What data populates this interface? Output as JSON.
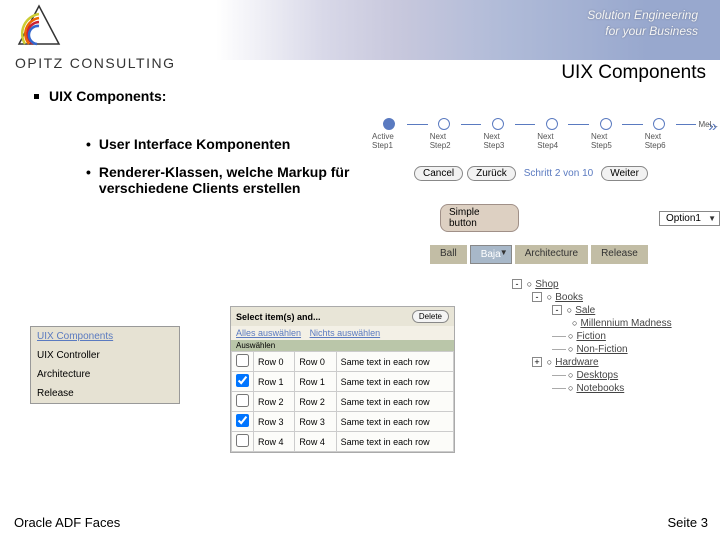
{
  "header": {
    "tagline_l1": "Solution Engineering",
    "tagline_l2": "for your Business",
    "logo_text_1": "OPITZ",
    "logo_text_2": "CONSULTING"
  },
  "page_title": "UIX Components",
  "subtitle": "UIX Components:",
  "bullets": [
    "User Interface Komponenten",
    "Renderer-Klassen, welche Markup für verschiedene Clients erstellen"
  ],
  "wizard": {
    "steps": [
      "Active Step1",
      "Next Step2",
      "Next Step3",
      "Next Step4",
      "Next Step5",
      "Next Step6",
      "Mel..."
    ]
  },
  "dlgnav": {
    "cancel": "Cancel",
    "back": "Zurück",
    "hint": "Schritt 2 von 10",
    "next": "Weiter"
  },
  "simple_button": "Simple button",
  "select_value": "Option1",
  "tabs": [
    "Ball",
    "Baja",
    "Architecture",
    "Release"
  ],
  "sidebar_list": [
    "UIX Components",
    "UIX Controller",
    "Architecture",
    "Release"
  ],
  "table": {
    "title": "Select item(s) and...",
    "delete": "Delete",
    "select_all": "Alles auswählen",
    "select_none": "Nichts auswählen",
    "auswaehlen": "Auswählen",
    "rows": [
      {
        "checked": false,
        "c1": "Row 0",
        "c2": "Row 0",
        "c3": "Same text in each row"
      },
      {
        "checked": true,
        "c1": "Row 1",
        "c2": "Row 1",
        "c3": "Same text in each row"
      },
      {
        "checked": false,
        "c1": "Row 2",
        "c2": "Row 2",
        "c3": "Same text in each row"
      },
      {
        "checked": true,
        "c1": "Row 3",
        "c2": "Row 3",
        "c3": "Same text in each row"
      },
      {
        "checked": false,
        "c1": "Row 4",
        "c2": "Row 4",
        "c3": "Same text in each row"
      }
    ]
  },
  "tree": [
    {
      "lvl": 0,
      "exp": "-",
      "label": "Shop"
    },
    {
      "lvl": 1,
      "exp": "-",
      "label": "Books"
    },
    {
      "lvl": 2,
      "exp": "-",
      "label": "Sale"
    },
    {
      "lvl": 3,
      "exp": "",
      "label": "Millennium Madness"
    },
    {
      "lvl": 2,
      "exp": "",
      "label": "Fiction",
      "branch": true
    },
    {
      "lvl": 2,
      "exp": "",
      "label": "Non-Fiction",
      "branch": true
    },
    {
      "lvl": 1,
      "exp": "+",
      "label": "Hardware"
    },
    {
      "lvl": 2,
      "exp": "",
      "label": "Desktops",
      "branch": true
    },
    {
      "lvl": 2,
      "exp": "",
      "label": "Notebooks",
      "branch": true
    }
  ],
  "footer": {
    "left": "Oracle ADF Faces",
    "right": "Seite 3"
  }
}
